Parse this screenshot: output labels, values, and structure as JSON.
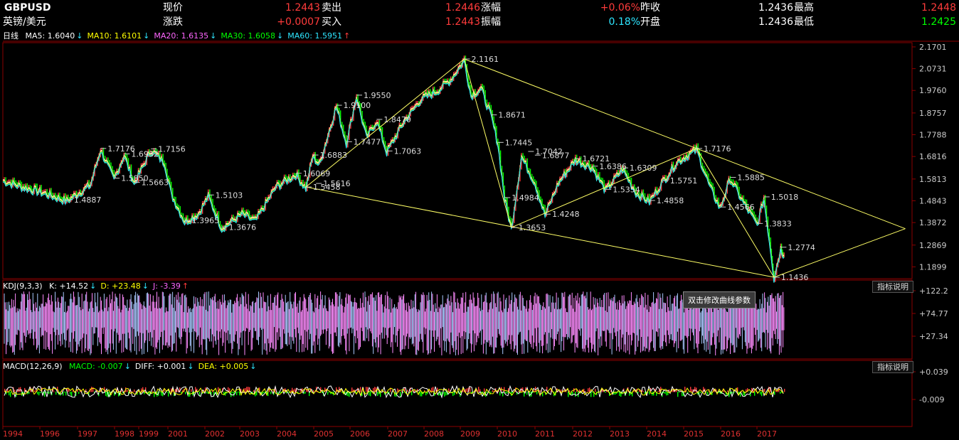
{
  "quote": {
    "symbol": "GBPUSD",
    "name": "英镑/美元",
    "row1": [
      {
        "label": "现价",
        "value": "1.2443"
      },
      {
        "label": "卖出",
        "value": "1.2446"
      },
      {
        "label": "涨幅",
        "value": "+0.06%"
      },
      {
        "label": "昨收",
        "value": "1.2436"
      },
      {
        "label": "最高",
        "value": "1.2448"
      }
    ],
    "row2": [
      {
        "label": "涨跌",
        "value": "+0.0007"
      },
      {
        "label": "买入",
        "value": "1.2443"
      },
      {
        "label": "振幅",
        "value": "0.18%"
      },
      {
        "label": "开盘",
        "value": "1.2436"
      },
      {
        "label": "最低",
        "value": "1.2425"
      }
    ]
  },
  "ma_legend": {
    "period": "日线",
    "items": [
      {
        "text": "MA5: 1.6040",
        "arrow": "↓",
        "color": "#ffffff"
      },
      {
        "text": "MA10: 1.6101",
        "arrow": "↓",
        "color": "#ffff00"
      },
      {
        "text": "MA20: 1.6135",
        "arrow": "↓",
        "color": "#ff66ff"
      },
      {
        "text": "MA30: 1.6058",
        "arrow": "↓",
        "color": "#00ff00"
      },
      {
        "text": "MA60: 1.5951",
        "arrow": "↑",
        "color": "#2ee6ff"
      }
    ]
  },
  "kdj_legend": {
    "name": "KDJ(9,3,3)",
    "items": [
      {
        "text": "K: +14.52",
        "arrow": "↓",
        "color": "#ffffff"
      },
      {
        "text": "D: +23.48",
        "arrow": "↓",
        "color": "#ffff00"
      },
      {
        "text": "J: -3.39",
        "arrow": "↑",
        "color": "#ff66ff"
      }
    ]
  },
  "macd_legend": {
    "name": "MACD(12,26,9)",
    "items": [
      {
        "text": "MACD: -0.007",
        "arrow": "↓",
        "color": "#00ff00"
      },
      {
        "text": "DIFF: +0.001",
        "arrow": "↓",
        "color": "#ffffff"
      },
      {
        "text": "DEA: +0.005",
        "arrow": "↓",
        "color": "#ffff00"
      }
    ]
  },
  "indicator_button": "指标说明",
  "tooltip": "双击修改曲线参数",
  "colors": {
    "up": "#ff3b3b",
    "down": "#00ff00",
    "grid": "#8b0000",
    "trend": "#ffff66"
  },
  "chart_data": {
    "type": "line",
    "x_labels": [
      "1994",
      "1996",
      "1997",
      "1998",
      "1999",
      "2001",
      "2002",
      "2003",
      "2004",
      "2005",
      "2006",
      "2007",
      "2008",
      "2009",
      "2010",
      "2011",
      "2012",
      "2013",
      "2014",
      "2015",
      "2016",
      "2017"
    ],
    "price_ticks": [
      "2.1701",
      "2.0731",
      "1.9760",
      "1.8757",
      "1.7788",
      "1.6816",
      "1.5813",
      "1.4843",
      "1.3872",
      "1.2869",
      "1.1899"
    ],
    "kdj_ticks": [
      "+122.2",
      "+74.77",
      "+27.34"
    ],
    "macd_ticks": [
      "+0.039",
      "-0.009"
    ],
    "price_series": [
      {
        "x": 1993.9,
        "y": 1.58
      },
      {
        "x": 1994.5,
        "y": 1.55
      },
      {
        "x": 1995.0,
        "y": 1.53
      },
      {
        "x": 1995.8,
        "y": 1.4887
      },
      {
        "x": 1996.5,
        "y": 1.56
      },
      {
        "x": 1996.8,
        "y": 1.7176
      },
      {
        "x": 1997.2,
        "y": 1.585
      },
      {
        "x": 1997.5,
        "y": 1.6932
      },
      {
        "x": 1997.8,
        "y": 1.5663
      },
      {
        "x": 1998.3,
        "y": 1.7156
      },
      {
        "x": 1998.7,
        "y": 1.66
      },
      {
        "x": 1998.9,
        "y": 1.52
      },
      {
        "x": 1999.3,
        "y": 1.3965
      },
      {
        "x": 1999.7,
        "y": 1.43
      },
      {
        "x": 2000.0,
        "y": 1.5103
      },
      {
        "x": 2000.4,
        "y": 1.3676
      },
      {
        "x": 2001.0,
        "y": 1.43
      },
      {
        "x": 2001.4,
        "y": 1.4
      },
      {
        "x": 2002.0,
        "y": 1.55
      },
      {
        "x": 2002.6,
        "y": 1.6069
      },
      {
        "x": 2002.9,
        "y": 1.5458
      },
      {
        "x": 2003.1,
        "y": 1.6883
      },
      {
        "x": 2003.3,
        "y": 1.65
      },
      {
        "x": 2003.8,
        "y": 1.91
      },
      {
        "x": 2004.1,
        "y": 1.7477
      },
      {
        "x": 2004.4,
        "y": 1.955
      },
      {
        "x": 2004.7,
        "y": 1.77
      },
      {
        "x": 2005.0,
        "y": 1.847
      },
      {
        "x": 2005.3,
        "y": 1.7063
      },
      {
        "x": 2005.8,
        "y": 1.84
      },
      {
        "x": 2006.3,
        "y": 1.94
      },
      {
        "x": 2006.8,
        "y": 1.98
      },
      {
        "x": 2007.2,
        "y": 2.03
      },
      {
        "x": 2007.6,
        "y": 2.1161
      },
      {
        "x": 2007.8,
        "y": 1.96
      },
      {
        "x": 2008.1,
        "y": 1.99
      },
      {
        "x": 2008.4,
        "y": 1.8671
      },
      {
        "x": 2008.6,
        "y": 1.7445
      },
      {
        "x": 2008.8,
        "y": 1.4984
      },
      {
        "x": 2009.0,
        "y": 1.3653
      },
      {
        "x": 2009.3,
        "y": 1.6877
      },
      {
        "x": 2009.7,
        "y": 1.57
      },
      {
        "x": 2010.0,
        "y": 1.4248
      },
      {
        "x": 2010.4,
        "y": 1.57
      },
      {
        "x": 2010.9,
        "y": 1.6721
      },
      {
        "x": 2011.4,
        "y": 1.6386
      },
      {
        "x": 2011.8,
        "y": 1.5354
      },
      {
        "x": 2012.3,
        "y": 1.6309
      },
      {
        "x": 2012.7,
        "y": 1.5267
      },
      {
        "x": 2013.1,
        "y": 1.4858
      },
      {
        "x": 2013.5,
        "y": 1.5751
      },
      {
        "x": 2013.9,
        "y": 1.66
      },
      {
        "x": 2014.5,
        "y": 1.7176
      },
      {
        "x": 2014.9,
        "y": 1.55
      },
      {
        "x": 2015.2,
        "y": 1.4566
      },
      {
        "x": 2015.5,
        "y": 1.5885
      },
      {
        "x": 2015.9,
        "y": 1.48
      },
      {
        "x": 2016.3,
        "y": 1.3833
      },
      {
        "x": 2016.5,
        "y": 1.5018
      },
      {
        "x": 2016.7,
        "y": 1.27
      },
      {
        "x": 2016.8,
        "y": 1.1436
      },
      {
        "x": 2017.0,
        "y": 1.2774
      },
      {
        "x": 2017.1,
        "y": 1.2443
      }
    ],
    "annotations": [
      {
        "x": 1995.8,
        "y": 1.4887,
        "label": "1.4887"
      },
      {
        "x": 1996.8,
        "y": 1.7176,
        "label": "1.7176"
      },
      {
        "x": 1997.2,
        "y": 1.585,
        "label": "1.5850"
      },
      {
        "x": 1997.5,
        "y": 1.6932,
        "label": "1.6932"
      },
      {
        "x": 1997.8,
        "y": 1.5663,
        "label": "1.5663"
      },
      {
        "x": 1998.3,
        "y": 1.7156,
        "label": "1.7156"
      },
      {
        "x": 1999.3,
        "y": 1.3965,
        "label": "1.3965"
      },
      {
        "x": 2000.0,
        "y": 1.5103,
        "label": "1.5103"
      },
      {
        "x": 2000.4,
        "y": 1.3676,
        "label": "1.3676"
      },
      {
        "x": 2002.6,
        "y": 1.6069,
        "label": "1.6069"
      },
      {
        "x": 2002.9,
        "y": 1.5458,
        "label": "1.5458"
      },
      {
        "x": 2003.1,
        "y": 1.6883,
        "label": "1.6883"
      },
      {
        "x": 2003.2,
        "y": 1.5616,
        "label": "1.5616"
      },
      {
        "x": 2003.8,
        "y": 1.91,
        "label": "1.9100"
      },
      {
        "x": 2004.1,
        "y": 1.7477,
        "label": "1.7477"
      },
      {
        "x": 2004.4,
        "y": 1.955,
        "label": "1.9550"
      },
      {
        "x": 2005.0,
        "y": 1.847,
        "label": "1.8470"
      },
      {
        "x": 2005.3,
        "y": 1.7063,
        "label": "1.7063"
      },
      {
        "x": 2007.6,
        "y": 2.1161,
        "label": "2.1161"
      },
      {
        "x": 2008.4,
        "y": 1.8671,
        "label": "1.8671"
      },
      {
        "x": 2008.6,
        "y": 1.7445,
        "label": "1.7445"
      },
      {
        "x": 2008.8,
        "y": 1.4984,
        "label": "1.4984"
      },
      {
        "x": 2009.0,
        "y": 1.3653,
        "label": "1.3653"
      },
      {
        "x": 2009.5,
        "y": 1.7042,
        "label": "1.7042"
      },
      {
        "x": 2009.7,
        "y": 1.6877,
        "label": "1.6877"
      },
      {
        "x": 2010.0,
        "y": 1.4248,
        "label": "1.4248"
      },
      {
        "x": 2010.9,
        "y": 1.6721,
        "label": "1.6721"
      },
      {
        "x": 2011.4,
        "y": 1.6386,
        "label": "1.6386"
      },
      {
        "x": 2011.8,
        "y": 1.5354,
        "label": "1.5354"
      },
      {
        "x": 2012.3,
        "y": 1.6309,
        "label": "1.6309"
      },
      {
        "x": 2013.1,
        "y": 1.4858,
        "label": "1.4858"
      },
      {
        "x": 2013.5,
        "y": 1.5751,
        "label": "1.5751"
      },
      {
        "x": 2014.5,
        "y": 1.7176,
        "label": "1.7176"
      },
      {
        "x": 2015.2,
        "y": 1.4566,
        "label": "1.4566"
      },
      {
        "x": 2015.5,
        "y": 1.5885,
        "label": "1.5885"
      },
      {
        "x": 2016.3,
        "y": 1.3833,
        "label": "1.3833"
      },
      {
        "x": 2016.5,
        "y": 1.5018,
        "label": "1.5018"
      },
      {
        "x": 2016.8,
        "y": 1.1436,
        "label": "1.1436"
      },
      {
        "x": 2017.0,
        "y": 1.2774,
        "label": "1.2774"
      }
    ],
    "trendlines": [
      {
        "x1": 2002.9,
        "y1": 1.5458,
        "x2": 2007.6,
        "y2": 2.1161
      },
      {
        "x1": 2002.9,
        "y1": 1.5458,
        "x2": 2016.8,
        "y2": 1.1436
      },
      {
        "x1": 2007.6,
        "y1": 2.1161,
        "x2": 2014.5,
        "y2": 1.7176
      },
      {
        "x1": 2014.5,
        "y1": 1.7176,
        "x2": 2020.7,
        "y2": 1.36
      },
      {
        "x1": 2016.8,
        "y1": 1.1436,
        "x2": 2020.7,
        "y2": 1.36
      },
      {
        "x1": 2007.6,
        "y1": 2.1161,
        "x2": 2009.0,
        "y2": 1.3653
      },
      {
        "x1": 2009.0,
        "y1": 1.3653,
        "x2": 2014.5,
        "y2": 1.7176
      },
      {
        "x1": 2014.5,
        "y1": 1.7176,
        "x2": 2016.8,
        "y2": 1.1436
      }
    ],
    "ylim": [
      1.15,
      2.17
    ],
    "xlim": [
      1993.9,
      2020.9
    ]
  }
}
